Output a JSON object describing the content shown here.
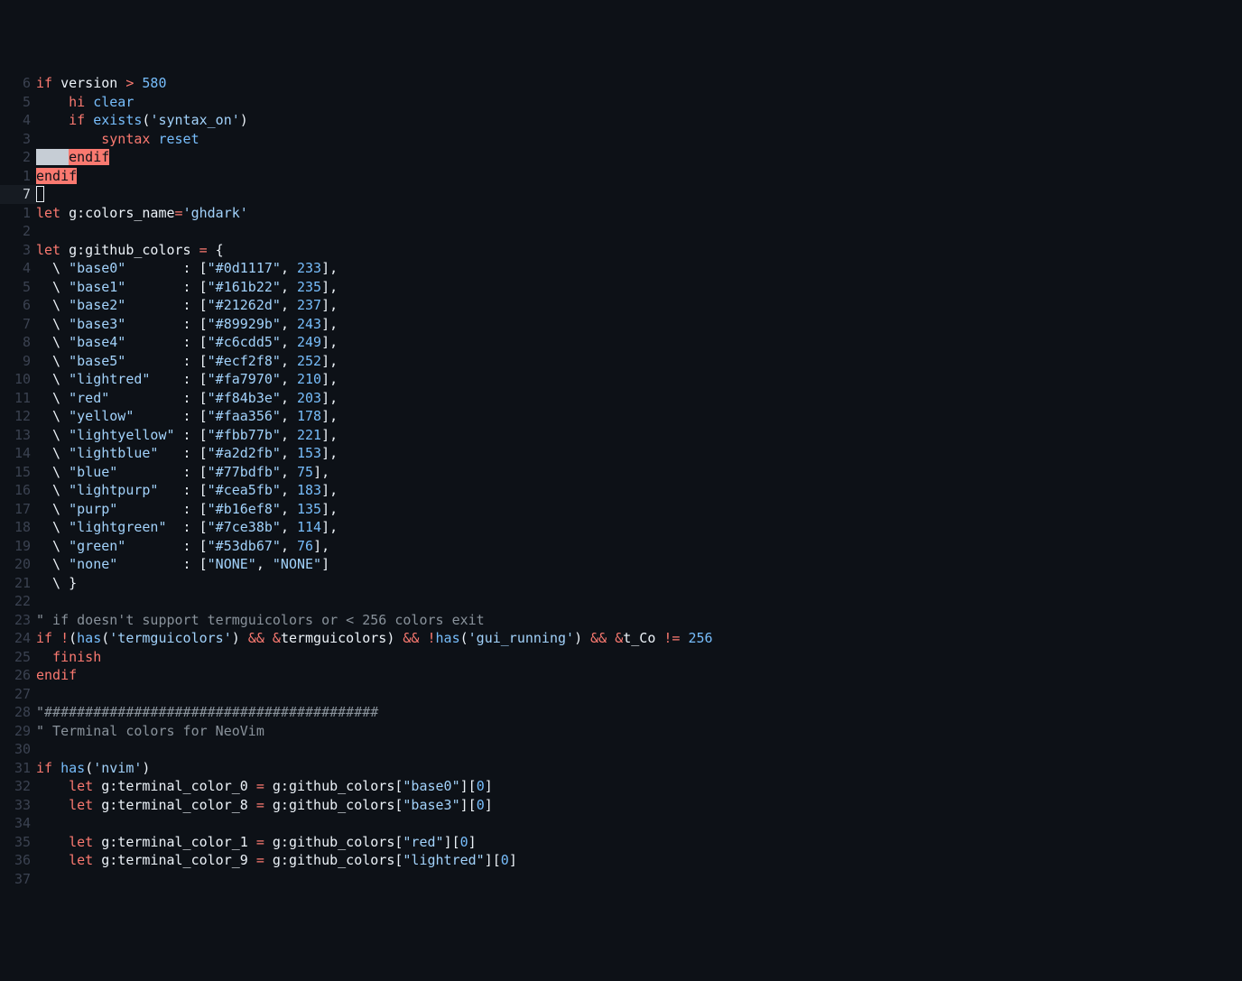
{
  "cursor_abs": 7,
  "lines": [
    {
      "rel": "6",
      "tokens": [
        [
          "kw",
          "if"
        ],
        [
          "fg",
          " version "
        ],
        [
          "kw",
          ">"
        ],
        [
          "fg",
          " "
        ],
        [
          "num",
          "580"
        ]
      ]
    },
    {
      "rel": "5",
      "tokens": [
        [
          "fg",
          "    "
        ],
        [
          "kw",
          "hi"
        ],
        [
          "fg",
          " "
        ],
        [
          "id",
          "clear"
        ]
      ]
    },
    {
      "rel": "4",
      "tokens": [
        [
          "fg",
          "    "
        ],
        [
          "kw",
          "if"
        ],
        [
          "fg",
          " "
        ],
        [
          "id",
          "exists"
        ],
        [
          "fg",
          "("
        ],
        [
          "str",
          "'syntax_on'"
        ],
        [
          "fg",
          ")"
        ]
      ]
    },
    {
      "rel": "3",
      "tokens": [
        [
          "fg",
          "        "
        ],
        [
          "kw",
          "syntax"
        ],
        [
          "fg",
          " "
        ],
        [
          "id",
          "reset"
        ]
      ]
    },
    {
      "rel": "2",
      "tokens": [
        [
          "selbg",
          "    "
        ],
        [
          "endkw",
          "endif"
        ]
      ]
    },
    {
      "rel": "1",
      "tokens": [
        [
          "endkw",
          "endif"
        ]
      ]
    },
    {
      "rel": "7",
      "cur": true,
      "tokens": [
        [
          "cursor",
          ""
        ]
      ]
    },
    {
      "rel": "1",
      "tokens": [
        [
          "kw",
          "let"
        ],
        [
          "fg",
          " g:colors_name"
        ],
        [
          "kw",
          "="
        ],
        [
          "str",
          "'ghdark'"
        ]
      ]
    },
    {
      "rel": "2",
      "tokens": []
    },
    {
      "rel": "3",
      "tokens": [
        [
          "kw",
          "let"
        ],
        [
          "fg",
          " g:github_colors "
        ],
        [
          "kw",
          "="
        ],
        [
          "fg",
          " {"
        ]
      ]
    },
    {
      "rel": "4",
      "tokens": [
        [
          "fg",
          "  \\ "
        ],
        [
          "str",
          "\"base0\""
        ],
        [
          "fg",
          "       : ["
        ],
        [
          "str",
          "\"#0d1117\""
        ],
        [
          "fg",
          ", "
        ],
        [
          "num",
          "233"
        ],
        [
          "fg",
          "],"
        ]
      ]
    },
    {
      "rel": "5",
      "tokens": [
        [
          "fg",
          "  \\ "
        ],
        [
          "str",
          "\"base1\""
        ],
        [
          "fg",
          "       : ["
        ],
        [
          "str",
          "\"#161b22\""
        ],
        [
          "fg",
          ", "
        ],
        [
          "num",
          "235"
        ],
        [
          "fg",
          "],"
        ]
      ]
    },
    {
      "rel": "6",
      "tokens": [
        [
          "fg",
          "  \\ "
        ],
        [
          "str",
          "\"base2\""
        ],
        [
          "fg",
          "       : ["
        ],
        [
          "str",
          "\"#21262d\""
        ],
        [
          "fg",
          ", "
        ],
        [
          "num",
          "237"
        ],
        [
          "fg",
          "],"
        ]
      ]
    },
    {
      "rel": "7",
      "tokens": [
        [
          "fg",
          "  \\ "
        ],
        [
          "str",
          "\"base3\""
        ],
        [
          "fg",
          "       : ["
        ],
        [
          "str",
          "\"#89929b\""
        ],
        [
          "fg",
          ", "
        ],
        [
          "num",
          "243"
        ],
        [
          "fg",
          "],"
        ]
      ]
    },
    {
      "rel": "8",
      "tokens": [
        [
          "fg",
          "  \\ "
        ],
        [
          "str",
          "\"base4\""
        ],
        [
          "fg",
          "       : ["
        ],
        [
          "str",
          "\"#c6cdd5\""
        ],
        [
          "fg",
          ", "
        ],
        [
          "num",
          "249"
        ],
        [
          "fg",
          "],"
        ]
      ]
    },
    {
      "rel": "9",
      "tokens": [
        [
          "fg",
          "  \\ "
        ],
        [
          "str",
          "\"base5\""
        ],
        [
          "fg",
          "       : ["
        ],
        [
          "str",
          "\"#ecf2f8\""
        ],
        [
          "fg",
          ", "
        ],
        [
          "num",
          "252"
        ],
        [
          "fg",
          "],"
        ]
      ]
    },
    {
      "rel": "10",
      "tokens": [
        [
          "fg",
          "  \\ "
        ],
        [
          "str",
          "\"lightred\""
        ],
        [
          "fg",
          "    : ["
        ],
        [
          "str",
          "\"#fa7970\""
        ],
        [
          "fg",
          ", "
        ],
        [
          "num",
          "210"
        ],
        [
          "fg",
          "],"
        ]
      ]
    },
    {
      "rel": "11",
      "tokens": [
        [
          "fg",
          "  \\ "
        ],
        [
          "str",
          "\"red\""
        ],
        [
          "fg",
          "         : ["
        ],
        [
          "str",
          "\"#f84b3e\""
        ],
        [
          "fg",
          ", "
        ],
        [
          "num",
          "203"
        ],
        [
          "fg",
          "],"
        ]
      ]
    },
    {
      "rel": "12",
      "tokens": [
        [
          "fg",
          "  \\ "
        ],
        [
          "str",
          "\"yellow\""
        ],
        [
          "fg",
          "      : ["
        ],
        [
          "str",
          "\"#faa356\""
        ],
        [
          "fg",
          ", "
        ],
        [
          "num",
          "178"
        ],
        [
          "fg",
          "],"
        ]
      ]
    },
    {
      "rel": "13",
      "tokens": [
        [
          "fg",
          "  \\ "
        ],
        [
          "str",
          "\"lightyellow\""
        ],
        [
          "fg",
          " : ["
        ],
        [
          "str",
          "\"#fbb77b\""
        ],
        [
          "fg",
          ", "
        ],
        [
          "num",
          "221"
        ],
        [
          "fg",
          "],"
        ]
      ]
    },
    {
      "rel": "14",
      "tokens": [
        [
          "fg",
          "  \\ "
        ],
        [
          "str",
          "\"lightblue\""
        ],
        [
          "fg",
          "   : ["
        ],
        [
          "str",
          "\"#a2d2fb\""
        ],
        [
          "fg",
          ", "
        ],
        [
          "num",
          "153"
        ],
        [
          "fg",
          "],"
        ]
      ]
    },
    {
      "rel": "15",
      "tokens": [
        [
          "fg",
          "  \\ "
        ],
        [
          "str",
          "\"blue\""
        ],
        [
          "fg",
          "        : ["
        ],
        [
          "str",
          "\"#77bdfb\""
        ],
        [
          "fg",
          ", "
        ],
        [
          "num",
          "75"
        ],
        [
          "fg",
          "],"
        ]
      ]
    },
    {
      "rel": "16",
      "tokens": [
        [
          "fg",
          "  \\ "
        ],
        [
          "str",
          "\"lightpurp\""
        ],
        [
          "fg",
          "   : ["
        ],
        [
          "str",
          "\"#cea5fb\""
        ],
        [
          "fg",
          ", "
        ],
        [
          "num",
          "183"
        ],
        [
          "fg",
          "],"
        ]
      ]
    },
    {
      "rel": "17",
      "tokens": [
        [
          "fg",
          "  \\ "
        ],
        [
          "str",
          "\"purp\""
        ],
        [
          "fg",
          "        : ["
        ],
        [
          "str",
          "\"#b16ef8\""
        ],
        [
          "fg",
          ", "
        ],
        [
          "num",
          "135"
        ],
        [
          "fg",
          "],"
        ]
      ]
    },
    {
      "rel": "18",
      "tokens": [
        [
          "fg",
          "  \\ "
        ],
        [
          "str",
          "\"lightgreen\""
        ],
        [
          "fg",
          "  : ["
        ],
        [
          "str",
          "\"#7ce38b\""
        ],
        [
          "fg",
          ", "
        ],
        [
          "num",
          "114"
        ],
        [
          "fg",
          "],"
        ]
      ]
    },
    {
      "rel": "19",
      "tokens": [
        [
          "fg",
          "  \\ "
        ],
        [
          "str",
          "\"green\""
        ],
        [
          "fg",
          "       : ["
        ],
        [
          "str",
          "\"#53db67\""
        ],
        [
          "fg",
          ", "
        ],
        [
          "num",
          "76"
        ],
        [
          "fg",
          "],"
        ]
      ]
    },
    {
      "rel": "20",
      "tokens": [
        [
          "fg",
          "  \\ "
        ],
        [
          "str",
          "\"none\""
        ],
        [
          "fg",
          "        : ["
        ],
        [
          "str",
          "\"NONE\""
        ],
        [
          "fg",
          ", "
        ],
        [
          "str",
          "\"NONE\""
        ],
        [
          "fg",
          "]"
        ]
      ]
    },
    {
      "rel": "21",
      "tokens": [
        [
          "fg",
          "  \\ }"
        ]
      ]
    },
    {
      "rel": "22",
      "tokens": []
    },
    {
      "rel": "23",
      "tokens": [
        [
          "cm",
          "\" if doesn't support termguicolors or < 256 colors exit"
        ]
      ]
    },
    {
      "rel": "24",
      "tokens": [
        [
          "kw",
          "if"
        ],
        [
          "fg",
          " "
        ],
        [
          "kw",
          "!"
        ],
        [
          "fg",
          "("
        ],
        [
          "id",
          "has"
        ],
        [
          "fg",
          "("
        ],
        [
          "str",
          "'termguicolors'"
        ],
        [
          "fg",
          ") "
        ],
        [
          "kw",
          "&&"
        ],
        [
          "fg",
          " "
        ],
        [
          "kw",
          "&"
        ],
        [
          "fg",
          "termguicolors) "
        ],
        [
          "kw",
          "&&"
        ],
        [
          "fg",
          " "
        ],
        [
          "kw",
          "!"
        ],
        [
          "id",
          "has"
        ],
        [
          "fg",
          "("
        ],
        [
          "str",
          "'gui_running'"
        ],
        [
          "fg",
          ") "
        ],
        [
          "kw",
          "&&"
        ],
        [
          "fg",
          " "
        ],
        [
          "kw",
          "&"
        ],
        [
          "fg",
          "t_Co "
        ],
        [
          "kw",
          "!="
        ],
        [
          "fg",
          " "
        ],
        [
          "num",
          "256"
        ]
      ]
    },
    {
      "rel": "25",
      "tokens": [
        [
          "fg",
          "  "
        ],
        [
          "kw",
          "finish"
        ]
      ]
    },
    {
      "rel": "26",
      "tokens": [
        [
          "kw",
          "endif"
        ]
      ]
    },
    {
      "rel": "27",
      "tokens": []
    },
    {
      "rel": "28",
      "tokens": [
        [
          "cm",
          "\"#########################################"
        ]
      ]
    },
    {
      "rel": "29",
      "tokens": [
        [
          "cm",
          "\" Terminal colors for NeoVim"
        ]
      ]
    },
    {
      "rel": "30",
      "tokens": []
    },
    {
      "rel": "31",
      "tokens": [
        [
          "kw",
          "if"
        ],
        [
          "fg",
          " "
        ],
        [
          "id",
          "has"
        ],
        [
          "fg",
          "("
        ],
        [
          "str",
          "'nvim'"
        ],
        [
          "fg",
          ")"
        ]
      ]
    },
    {
      "rel": "32",
      "tokens": [
        [
          "fg",
          "    "
        ],
        [
          "kw",
          "let"
        ],
        [
          "fg",
          " g:terminal_color_0 "
        ],
        [
          "kw",
          "="
        ],
        [
          "fg",
          " g:github_colors["
        ],
        [
          "str",
          "\"base0\""
        ],
        [
          "fg",
          "]["
        ],
        [
          "num",
          "0"
        ],
        [
          "fg",
          "]"
        ]
      ]
    },
    {
      "rel": "33",
      "tokens": [
        [
          "fg",
          "    "
        ],
        [
          "kw",
          "let"
        ],
        [
          "fg",
          " g:terminal_color_8 "
        ],
        [
          "kw",
          "="
        ],
        [
          "fg",
          " g:github_colors["
        ],
        [
          "str",
          "\"base3\""
        ],
        [
          "fg",
          "]["
        ],
        [
          "num",
          "0"
        ],
        [
          "fg",
          "]"
        ]
      ]
    },
    {
      "rel": "34",
      "tokens": []
    },
    {
      "rel": "35",
      "tokens": [
        [
          "fg",
          "    "
        ],
        [
          "kw",
          "let"
        ],
        [
          "fg",
          " g:terminal_color_1 "
        ],
        [
          "kw",
          "="
        ],
        [
          "fg",
          " g:github_colors["
        ],
        [
          "str",
          "\"red\""
        ],
        [
          "fg",
          "]["
        ],
        [
          "num",
          "0"
        ],
        [
          "fg",
          "]"
        ]
      ]
    },
    {
      "rel": "36",
      "tokens": [
        [
          "fg",
          "    "
        ],
        [
          "kw",
          "let"
        ],
        [
          "fg",
          " g:terminal_color_9 "
        ],
        [
          "kw",
          "="
        ],
        [
          "fg",
          " g:github_colors["
        ],
        [
          "str",
          "\"lightred\""
        ],
        [
          "fg",
          "]["
        ],
        [
          "num",
          "0"
        ],
        [
          "fg",
          "]"
        ]
      ]
    },
    {
      "rel": "37",
      "tokens": []
    }
  ]
}
